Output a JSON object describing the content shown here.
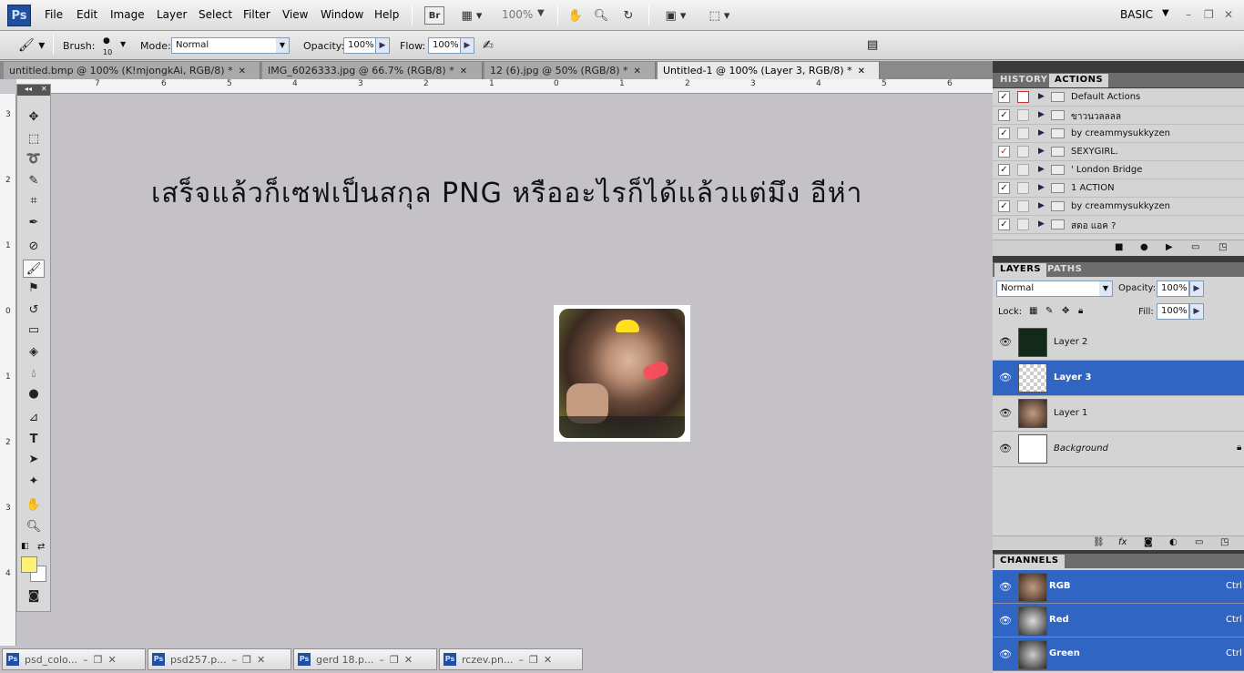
{
  "app": {
    "logo": "Ps",
    "workspace": "BASIC",
    "zoom": "100%"
  },
  "menu": [
    "File",
    "Edit",
    "Image",
    "Layer",
    "Select",
    "Filter",
    "View",
    "Window",
    "Help"
  ],
  "menubar_icons": [
    "bridge-icon",
    "screen-mode-icon",
    "hand-icon",
    "zoom-icon",
    "rotate-icon",
    "arrange-icon",
    "screen-icon"
  ],
  "bridge_label": "Br",
  "options": {
    "brush_label": "Brush:",
    "brush_size": "10",
    "mode_label": "Mode:",
    "mode_value": "Normal",
    "opacity_label": "Opacity:",
    "opacity_value": "100%",
    "flow_label": "Flow:",
    "flow_value": "100%"
  },
  "tabs": [
    {
      "label": "untitled.bmp @ 100% (K!mjongkAi, RGB/8) *"
    },
    {
      "label": "IMG_6026333.jpg @ 66.7% (RGB/8) *"
    },
    {
      "label": "12 (6).jpg @ 50% (RGB/8) *"
    },
    {
      "label": "Untitled-1 @ 100% (Layer 3, RGB/8) *"
    }
  ],
  "ruler_h": [
    "7",
    "6",
    "5",
    "4",
    "3",
    "2",
    "1",
    "0",
    "1",
    "2",
    "3",
    "4",
    "5",
    "6"
  ],
  "ruler_v": [
    "3",
    "2",
    "1",
    "0",
    "1",
    "2",
    "3",
    "4"
  ],
  "canvas": {
    "text": "เสร็จแล้วก็เซฟเป็นสกุล PNG หรืออะไรก็ได้แล้วแต่มึง อีห่า"
  },
  "minimized": [
    {
      "label": "psd_colo..."
    },
    {
      "label": "psd257.p..."
    },
    {
      "label": "gerd 18.p..."
    },
    {
      "label": "rczev.pn..."
    }
  ],
  "history_panel": {
    "tab_history": "HISTORY",
    "tab_actions": "ACTIONS",
    "actions": [
      {
        "name": "Default Actions"
      },
      {
        "name": "ขาวนวลลลล"
      },
      {
        "name": "by creammysukkyzen"
      },
      {
        "name": "SEXYGIRL."
      },
      {
        "name": "' London Bridge"
      },
      {
        "name": "1 ACTION"
      },
      {
        "name": "by creammysukkyzen"
      },
      {
        "name": "สดอ แอค ?"
      }
    ]
  },
  "layers_panel": {
    "tab_layers": "LAYERS",
    "tab_paths": "PATHS",
    "blend_mode": "Normal",
    "opacity_label": "Opacity:",
    "opacity_value": "100%",
    "lock_label": "Lock:",
    "fill_label": "Fill:",
    "fill_value": "100%",
    "layers": [
      {
        "name": "Layer 2"
      },
      {
        "name": "Layer 3"
      },
      {
        "name": "Layer 1"
      },
      {
        "name": "Background"
      }
    ]
  },
  "channels_panel": {
    "tab_channels": "CHANNELS",
    "channels": [
      {
        "name": "RGB",
        "shortcut": "Ctrl"
      },
      {
        "name": "Red",
        "shortcut": "Ctrl"
      },
      {
        "name": "Green",
        "shortcut": "Ctrl"
      }
    ]
  },
  "colors": {
    "foreground": "#fff178",
    "background": "#ffffff",
    "selection": "#3165c4"
  }
}
